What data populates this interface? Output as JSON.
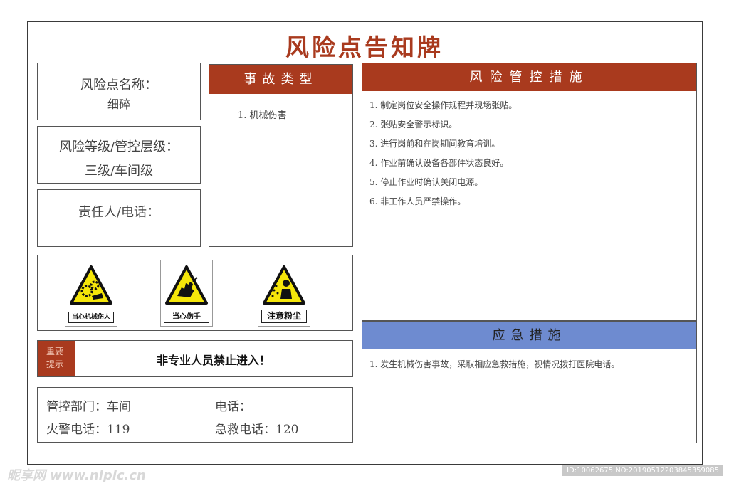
{
  "page": {
    "title": "风险点告知牌"
  },
  "info": {
    "name_label": "风险点名称：",
    "name_value": "细碎",
    "level_label": "风险等级/管控层级：",
    "level_value": "三级/车间级",
    "person_label": "责任人/电话："
  },
  "accident": {
    "header": "事故类型",
    "items": [
      "1.  机械伤害"
    ]
  },
  "risk_control": {
    "header": "风险管控措施",
    "items": [
      "1. 制定岗位安全操作规程并现场张贴。",
      "2. 张贴安全警示标识。",
      "3. 进行岗前和在岗期间教育培训。",
      "4. 作业前确认设备各部件状态良好。",
      "5. 停止作业时确认关闭电源。",
      "6. 非工作人员严禁操作。"
    ]
  },
  "emergency": {
    "header": "应急措施",
    "items": [
      "1. 发生机械伤害事故，采取相应急救措施，视情况拨打医院电话。"
    ]
  },
  "signs": [
    {
      "label": "当心机械伤人",
      "icon": "gear-hand-warning-icon"
    },
    {
      "label": "当心伤手",
      "icon": "hand-injury-warning-icon"
    },
    {
      "label": "注意粉尘",
      "icon": "dust-warning-icon"
    }
  ],
  "notice": {
    "tag_line1": "重要",
    "tag_line2": "提示",
    "text": "非专业人员禁止进入！"
  },
  "contacts": {
    "dept_label": "管控部门：车间",
    "phone_label": "电话：",
    "fire_label": "火警电话：119",
    "ambulance_label": "急救电话：120"
  },
  "watermark": {
    "left": "昵享网 www.nipic.cn",
    "right": "ID:10062675 NO:20190512203845359085"
  },
  "colors": {
    "accent_red": "#a93a1e",
    "accent_blue": "#6e8bd0",
    "warning_yellow": "#f5e60a"
  }
}
